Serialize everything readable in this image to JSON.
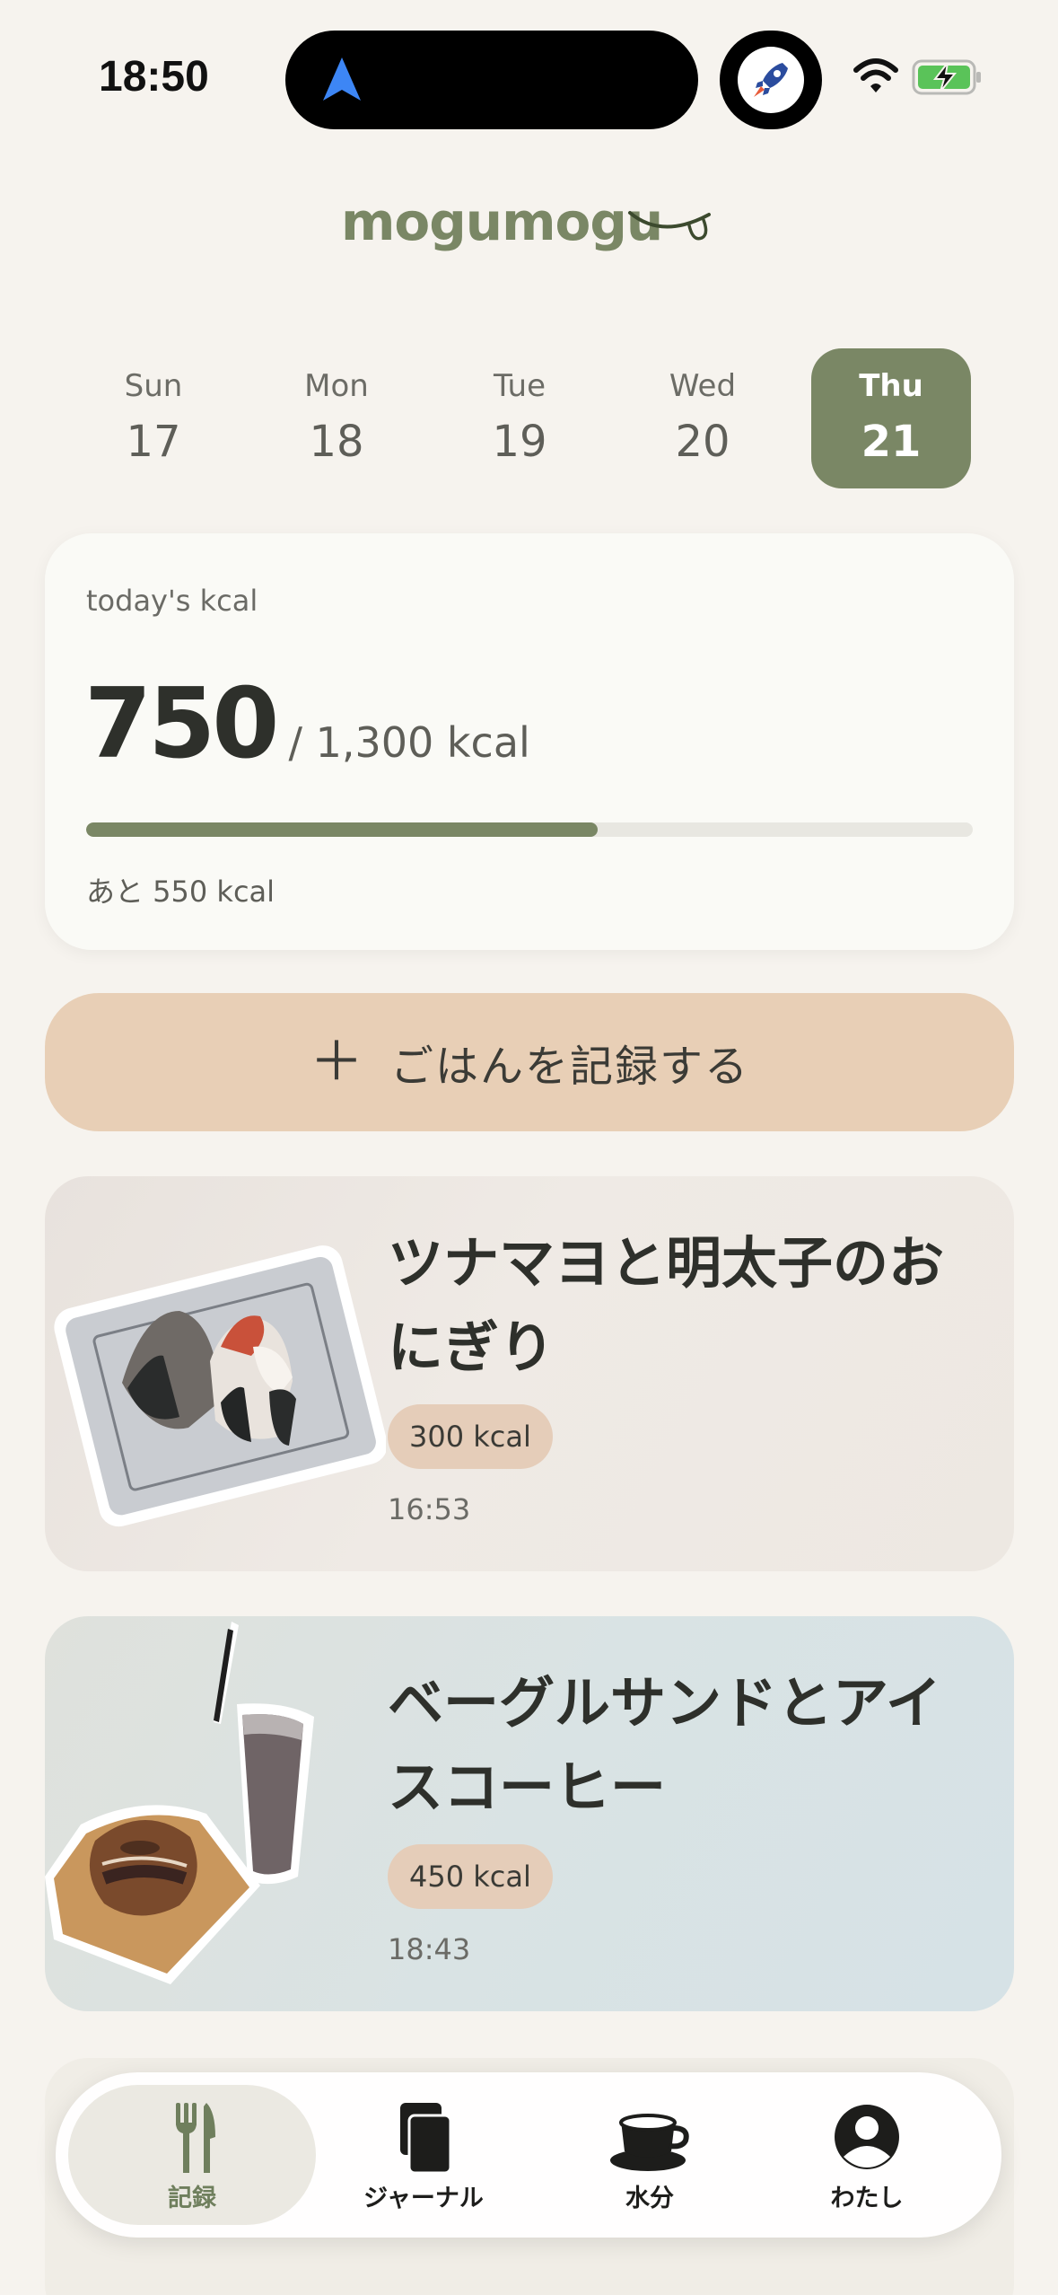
{
  "status_bar": {
    "time": "18:50"
  },
  "app": {
    "logo_text": "mogumogu"
  },
  "week": {
    "days": [
      {
        "name": "Sun",
        "date": "17",
        "selected": false
      },
      {
        "name": "Mon",
        "date": "18",
        "selected": false
      },
      {
        "name": "Tue",
        "date": "19",
        "selected": false
      },
      {
        "name": "Wed",
        "date": "20",
        "selected": false
      },
      {
        "name": "Thu",
        "date": "21",
        "selected": true
      }
    ]
  },
  "kcal_card": {
    "label": "today's kcal",
    "value": "750",
    "goal": "/ 1,300 kcal",
    "progress_fraction": 0.577,
    "remaining": "あと 550 kcal"
  },
  "add_button": {
    "icon": "plus-icon",
    "label": "ごはんを記録する"
  },
  "meals": [
    {
      "title": "ツナマヨと明太子のおにぎり",
      "kcal": "300 kcal",
      "time": "16:53"
    },
    {
      "title": "ベーグルサンドとアイスコーヒー",
      "kcal": "450 kcal",
      "time": "18:43"
    }
  ],
  "tab_bar": {
    "tabs": [
      {
        "label": "記録",
        "icon": "fork-knife-icon",
        "active": true
      },
      {
        "label": "ジャーナル",
        "icon": "journal-icon",
        "active": false
      },
      {
        "label": "水分",
        "icon": "cup-icon",
        "active": false
      },
      {
        "label": "わたし",
        "icon": "person-icon",
        "active": false
      }
    ]
  },
  "colors": {
    "accent": "#7a8765",
    "background": "#f6f3ee",
    "button": "#e8cfb6",
    "badge": "#e5cdb9"
  }
}
